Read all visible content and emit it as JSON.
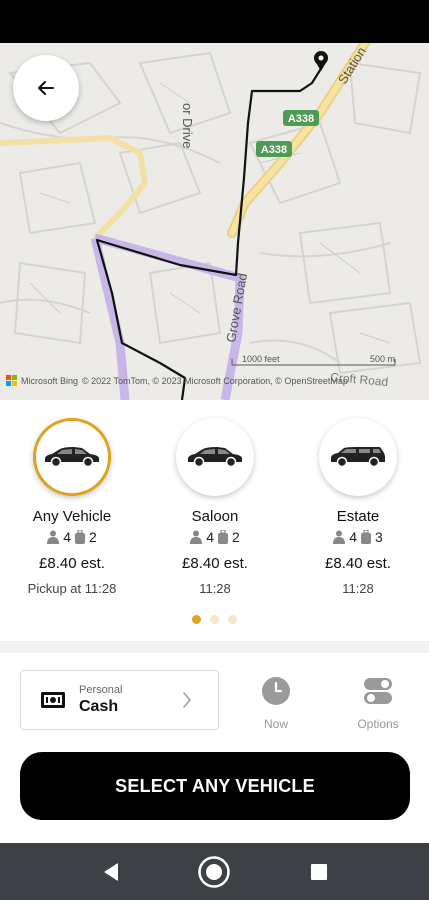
{
  "map": {
    "road_labels": [
      "A338",
      "A338",
      "Grove Road",
      "Station",
      "or Drive",
      "Croft Road"
    ],
    "scale_labels": [
      "1000 feet",
      "500 m"
    ],
    "attribution": "Microsoft Bing",
    "copyright": "© 2022 TomTom, © 2023 Microsoft Corporation, © OpenStreetMap"
  },
  "vehicles": [
    {
      "name": "Any Vehicle",
      "passengers": "4",
      "bags": "2",
      "price": "£8.40 est.",
      "subtext": "Pickup at 11:28",
      "selected": true
    },
    {
      "name": "Saloon",
      "passengers": "4",
      "bags": "2",
      "price": "£8.40 est.",
      "subtext": "11:28",
      "selected": false
    },
    {
      "name": "Estate",
      "passengers": "4",
      "bags": "3",
      "price": "£8.40 est.",
      "subtext": "11:28",
      "selected": false
    }
  ],
  "pagination": {
    "count": 3,
    "active": 0
  },
  "payment": {
    "type_label": "Personal",
    "method": "Cash"
  },
  "actions": {
    "time_label": "Now",
    "options_label": "Options"
  },
  "cta": {
    "label": "SELECT ANY VEHICLE"
  },
  "colors": {
    "accent": "#e0a21b",
    "route_highlight": "#c9b6e8",
    "road_yellow": "#f1cf7a",
    "shield_green": "#4f9a55"
  },
  "icons": [
    "back-arrow-icon",
    "car-icon",
    "person-icon",
    "luggage-icon",
    "cash-icon",
    "chevron-right-icon",
    "clock-icon",
    "toggle-icon",
    "nav-back-icon",
    "nav-home-icon",
    "nav-recents-icon",
    "destination-pin-icon"
  ]
}
